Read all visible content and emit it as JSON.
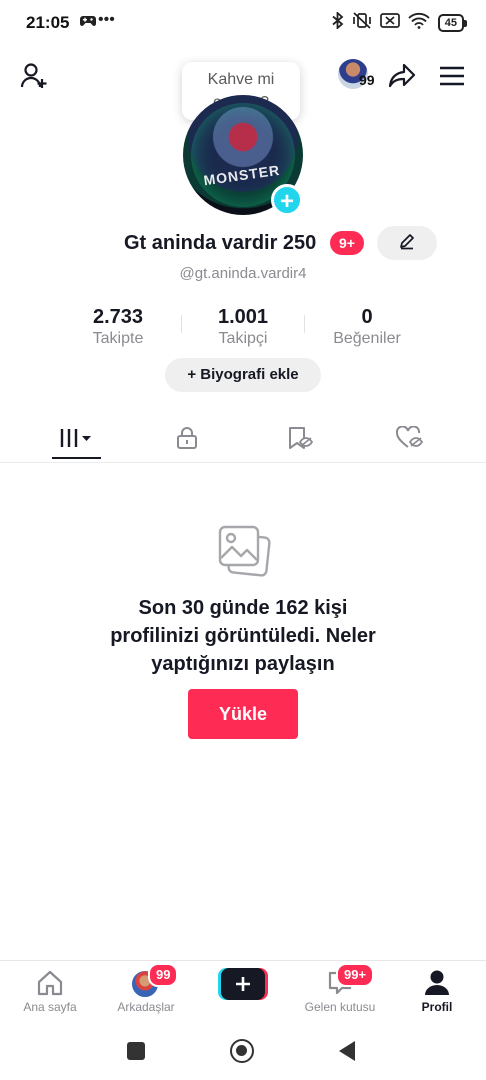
{
  "status_bar": {
    "time": "21:05",
    "notif_dots": "•••",
    "battery": "45"
  },
  "header": {
    "bubble_line1": "Kahve mi",
    "bubble_line2": "çay mı?",
    "mini_avatar_count": "99"
  },
  "profile": {
    "name": "Gt aninda vardir 250",
    "name_badge": "9+",
    "handle": "@gt.aninda.vardir4",
    "avatar_band_text": "MONSTER"
  },
  "stats": [
    {
      "value": "2.733",
      "label": "Takipte"
    },
    {
      "value": "1.001",
      "label": "Takipçi"
    },
    {
      "value": "0",
      "label": "Beğeniler"
    }
  ],
  "bio_button": "+ Biyografi ekle",
  "empty_state": {
    "line1": "Son 30 günde 162 kişi",
    "line2": "profilinizi görüntüledi. Neler",
    "line3": "yaptığınızı paylaşın",
    "button": "Yükle"
  },
  "bottom_nav": {
    "home": "Ana sayfa",
    "friends": "Arkadaşlar",
    "friends_badge": "99",
    "inbox": "Gelen kutusu",
    "inbox_badge": "99+",
    "profile": "Profil"
  },
  "colors": {
    "accent": "#fe2c55",
    "cyan": "#20d5ec",
    "text": "#161823",
    "muted": "#8a8b91"
  }
}
